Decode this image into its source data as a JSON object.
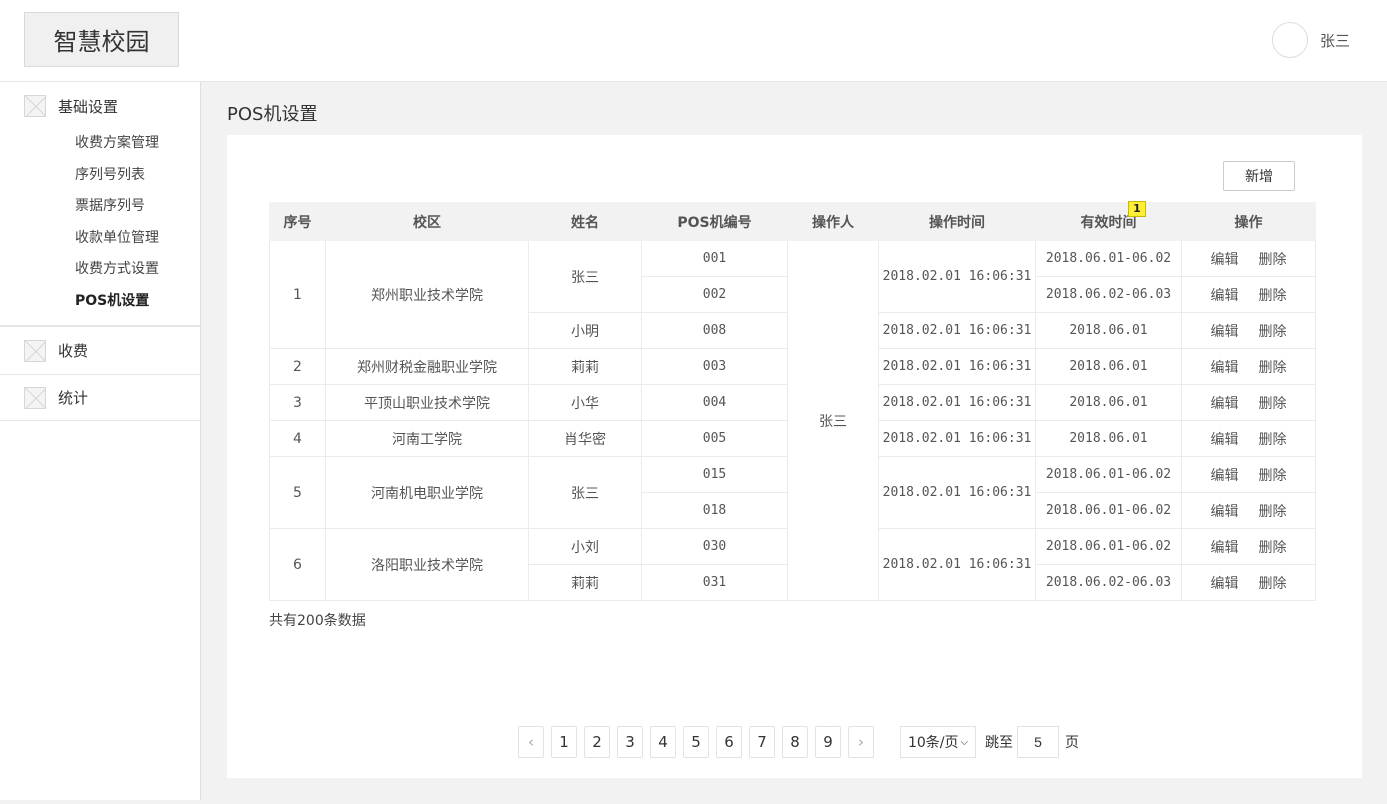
{
  "header": {
    "logo": "智慧校园",
    "username": "张三"
  },
  "sidebar": {
    "groups": [
      {
        "title": "基础设置",
        "items": [
          "收费方案管理",
          "序列号列表",
          "票据序列号",
          "收款单位管理",
          "收费方式设置",
          "POS机设置"
        ]
      },
      {
        "title": "收费"
      },
      {
        "title": "统计"
      }
    ]
  },
  "main": {
    "title": "POS机设置",
    "add_label": "新增",
    "badge": "1",
    "columns": [
      "序号",
      "校区",
      "姓名",
      "POS机编号",
      "操作人",
      "操作时间",
      "有效时间",
      "操作"
    ],
    "rows": [
      {
        "seq": "1",
        "campus": "郑州职业技术学院",
        "name_a": "张三",
        "pos1": "001",
        "operator": "张三",
        "op_time_a": "2018.02.01 16:06:31",
        "valid1": "2018.06.01-06.02"
      },
      {
        "pos2": "002",
        "valid2": "2018.06.02-06.03"
      },
      {
        "name_b": "小明",
        "pos3": "008",
        "op_time_b": "2018.02.01 16:06:31",
        "valid3": "2018.06.01"
      },
      {
        "seq": "2",
        "campus": "郑州财税金融职业学院",
        "name": "莉莉",
        "pos": "003",
        "op_time": "2018.02.01 16:06:31",
        "valid": "2018.06.01"
      },
      {
        "seq": "3",
        "campus": "平顶山职业技术学院",
        "name": "小华",
        "pos": "004",
        "op_time": "2018.02.01 16:06:31",
        "valid": "2018.06.01"
      },
      {
        "seq": "4",
        "campus": "河南工学院",
        "name": "肖华密",
        "pos": "005",
        "op_time": "2018.02.01 16:06:31",
        "valid": "2018.06.01"
      },
      {
        "seq": "5",
        "campus": "河南机电职业学院",
        "name": "张三",
        "pos1": "015",
        "pos2": "018",
        "op_time": "2018.02.01 16:06:31",
        "valid1": "2018.06.01-06.02",
        "valid2": "2018.06.01-06.02"
      },
      {
        "seq": "6",
        "campus": "洛阳职业技术学院",
        "name1": "小刘",
        "name2": "莉莉",
        "pos1": "030",
        "pos2": "031",
        "op_time": "2018.02.01 16:06:31",
        "valid1": "2018.06.01-06.02",
        "valid2": "2018.06.02-06.03"
      }
    ],
    "actions": {
      "edit": "编辑",
      "delete": "删除"
    },
    "total": "共有200条数据"
  },
  "pagination": {
    "prev": "‹",
    "next": "›",
    "pages": [
      "1",
      "2",
      "3",
      "4",
      "5",
      "6",
      "7",
      "8",
      "9"
    ],
    "page_size": "10条/页",
    "jump_label": "跳至",
    "jump_value": "5",
    "page_unit": "页"
  }
}
